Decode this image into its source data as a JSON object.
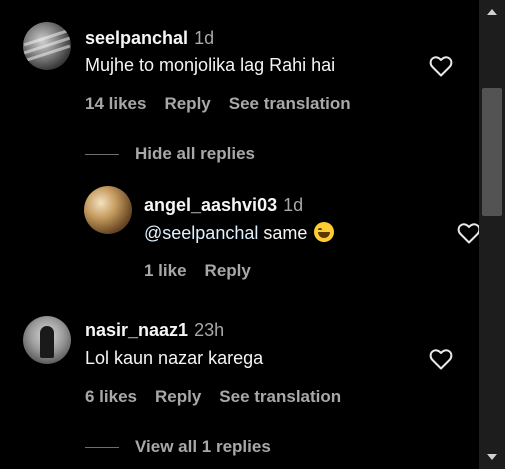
{
  "comments": [
    {
      "username": "seelpanchal",
      "time": "1d",
      "text": "Mujhe to monjolika lag Rahi hai",
      "likes": "14 likes",
      "reply": "Reply",
      "translate": "See translation",
      "replies_toggle": "Hide all replies",
      "avatar_icon": "user-avatar"
    },
    {
      "username": "angel_aashvi03",
      "time": "1d",
      "mention": "@seelpanchal",
      "text": "same",
      "emoji": "laughing-emoji",
      "likes": "1 like",
      "reply": "Reply",
      "avatar_icon": "user-avatar"
    },
    {
      "username": "nasir_naaz1",
      "time": "23h",
      "text": "Lol kaun nazar karega",
      "likes": "6 likes",
      "reply": "Reply",
      "translate": "See translation",
      "replies_toggle": "View all 1 replies",
      "avatar_icon": "user-avatar"
    }
  ],
  "colors": {
    "background": "#000000",
    "text_primary": "#f5f5f5",
    "text_secondary": "#a8a8a8",
    "mention": "#e0f1ff"
  }
}
